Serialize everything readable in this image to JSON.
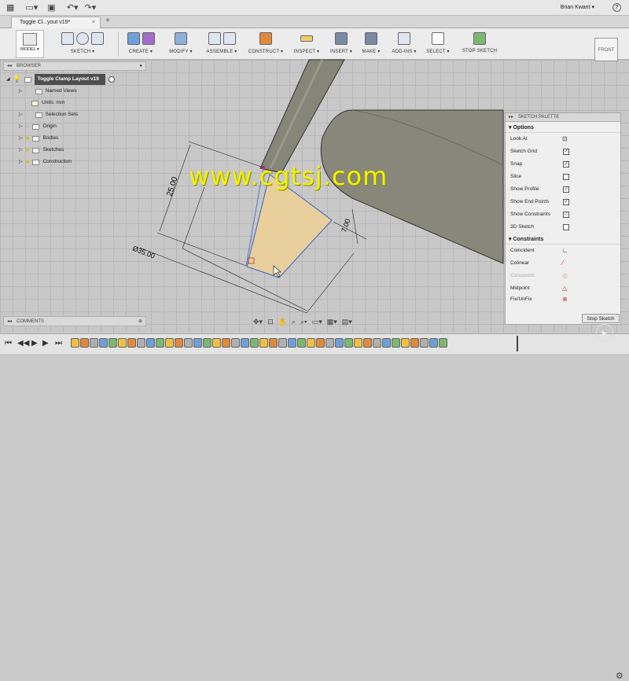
{
  "topbar": {
    "user": "Brian Kwant",
    "user_caret": "▾",
    "help": "?"
  },
  "tab": {
    "title": "Toggle Cl...yout v19*",
    "close": "×",
    "new": "+"
  },
  "toolbar": {
    "model": "MODEL ▾",
    "groups": [
      {
        "label": "SKETCH ▾"
      },
      {
        "label": "CREATE ▾"
      },
      {
        "label": "MODIFY ▾"
      },
      {
        "label": "ASSEMBLE ▾"
      },
      {
        "label": "CONSTRUCT ▾"
      },
      {
        "label": "INSPECT ▾"
      },
      {
        "label": "INSERT ▾"
      },
      {
        "label": "MAKE ▾"
      },
      {
        "label": "ADD-INS ▾"
      },
      {
        "label": "SELECT ▾"
      },
      {
        "label": "STOP SKETCH"
      }
    ],
    "viewcube": "FRONT"
  },
  "browser": {
    "header": "BROWSER",
    "root": "Toggle Clamp Layout v19",
    "items": [
      {
        "label": "Named Views"
      },
      {
        "label": "Units: mm"
      },
      {
        "label": "Selection Sets"
      },
      {
        "label": "Origin"
      },
      {
        "label": "Bodies"
      },
      {
        "label": "Sketches"
      },
      {
        "label": "Construction"
      }
    ]
  },
  "dimensions": {
    "d1": "25.00",
    "d2": "7.00",
    "d3": "Ø35.00"
  },
  "watermark": "www.cgtsj.com",
  "palette": {
    "header": "SKETCH PALETTE",
    "options_title": "Options",
    "options": [
      {
        "label": "Look At",
        "checked": null
      },
      {
        "label": "Sketch Grid",
        "checked": true
      },
      {
        "label": "Snap",
        "checked": true
      },
      {
        "label": "Slice",
        "checked": false
      },
      {
        "label": "Show Profile",
        "checked": true
      },
      {
        "label": "Show End Points",
        "checked": true
      },
      {
        "label": "Show Constraints",
        "checked": true
      },
      {
        "label": "3D Sketch",
        "checked": false
      }
    ],
    "constraints_title": "Constraints",
    "constraints": [
      {
        "label": "Coincident"
      },
      {
        "label": "Colinear"
      },
      {
        "label": "Concentric"
      },
      {
        "label": "Midpoint"
      },
      {
        "label": "Fix/UnFix"
      }
    ],
    "stop_button": "Stop Sketch"
  },
  "comments": {
    "header": "COMMENTS"
  },
  "colors": {
    "profile_fill": "#e8cf9c",
    "tube": "#8a8a7c",
    "accent_blue": "#3a66c4"
  }
}
